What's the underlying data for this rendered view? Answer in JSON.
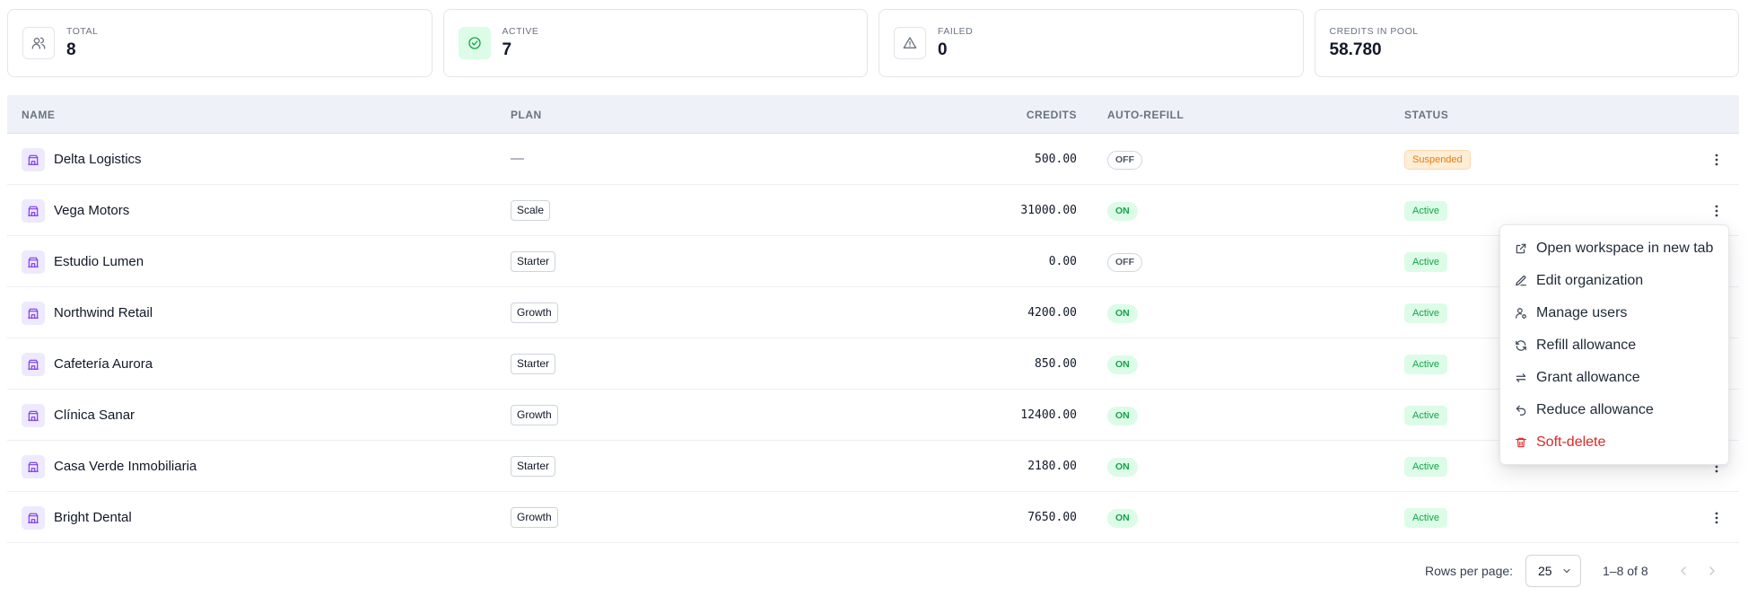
{
  "stats": [
    {
      "label": "TOTAL",
      "value": "8",
      "icon": "users-icon"
    },
    {
      "label": "ACTIVE",
      "value": "7",
      "icon": "check-circle-icon"
    },
    {
      "label": "FAILED",
      "value": "0",
      "icon": "warning-triangle-icon"
    },
    {
      "label": "CREDITS IN POOL",
      "value": "58.780"
    }
  ],
  "table": {
    "columns": {
      "name": "NAME",
      "plan": "PLAN",
      "credits": "CREDITS",
      "auto_refill": "AUTO-REFILL",
      "status": "STATUS"
    },
    "rows": [
      {
        "name": "Delta Logistics",
        "plan": "—",
        "credits": "500.00",
        "auto_refill": "OFF",
        "status": "Suspended"
      },
      {
        "name": "Vega Motors",
        "plan": "Scale",
        "credits": "31000.00",
        "auto_refill": "ON",
        "status": "Active"
      },
      {
        "name": "Estudio Lumen",
        "plan": "Starter",
        "credits": "0.00",
        "auto_refill": "OFF",
        "status": "Active"
      },
      {
        "name": "Northwind Retail",
        "plan": "Growth",
        "credits": "4200.00",
        "auto_refill": "ON",
        "status": "Active"
      },
      {
        "name": "Cafetería Aurora",
        "plan": "Starter",
        "credits": "850.00",
        "auto_refill": "ON",
        "status": "Active"
      },
      {
        "name": "Clínica Sanar",
        "plan": "Growth",
        "credits": "12400.00",
        "auto_refill": "ON",
        "status": "Active"
      },
      {
        "name": "Casa Verde Inmobiliaria",
        "plan": "Starter",
        "credits": "2180.00",
        "auto_refill": "ON",
        "status": "Active"
      },
      {
        "name": "Bright Dental",
        "plan": "Growth",
        "credits": "7650.00",
        "auto_refill": "ON",
        "status": "Active"
      }
    ]
  },
  "pagination": {
    "rows_per_page_label": "Rows per page:",
    "rows_per_page_value": "25",
    "range": "1–8 of 8"
  },
  "context_menu": {
    "items": [
      {
        "label": "Open workspace in new tab",
        "icon": "external-link-icon"
      },
      {
        "label": "Edit organization",
        "icon": "edit-icon"
      },
      {
        "label": "Manage users",
        "icon": "user-settings-icon"
      },
      {
        "label": "Refill allowance",
        "icon": "refresh-icon"
      },
      {
        "label": "Grant allowance",
        "icon": "transfer-icon"
      },
      {
        "label": "Reduce allowance",
        "icon": "undo-icon"
      },
      {
        "label": "Soft-delete",
        "icon": "trash-icon"
      }
    ]
  },
  "colors": {
    "accent_purple": "#7c3aed",
    "active_green": "#16a34a",
    "suspended_orange": "#ea7a0c",
    "danger_red": "#dc2626",
    "header_bg": "#eef2f8"
  }
}
